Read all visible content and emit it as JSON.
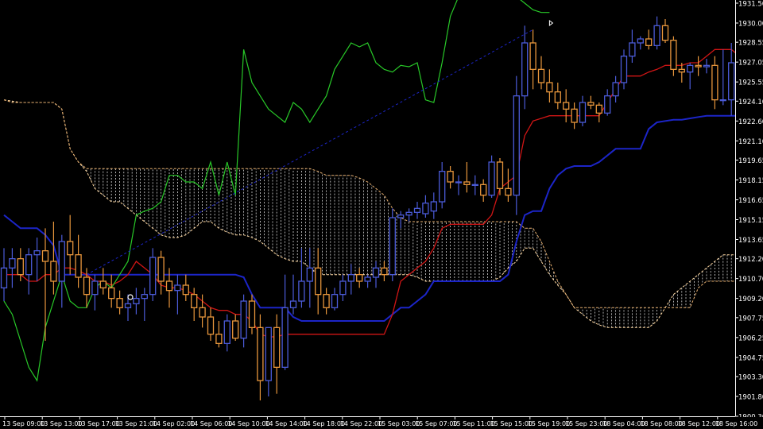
{
  "chart_data": {
    "type": "candlestick",
    "symbol": "",
    "timeframe": "H1",
    "ylim": [
      1900.3,
      1931.5
    ],
    "y_ticks": [
      "1931.50",
      "1930.00",
      "1928.55",
      "1927.05",
      "1925.55",
      "1924.10",
      "1922.60",
      "1921.10",
      "1919.65",
      "1918.15",
      "1916.65",
      "1915.15",
      "1913.65",
      "1912.20",
      "1910.70",
      "1909.20",
      "1907.75",
      "1906.25",
      "1904.75",
      "1903.30",
      "1901.80",
      "1900.30"
    ],
    "x_ticks": [
      "13 Sep 09:00",
      "13 Sep 13:00",
      "13 Sep 17:00",
      "13 Sep 21:00",
      "14 Sep 02:00",
      "14 Sep 06:00",
      "14 Sep 10:00",
      "14 Sep 14:00",
      "14 Sep 18:00",
      "14 Sep 22:00",
      "15 Sep 03:00",
      "15 Sep 07:00",
      "15 Sep 11:00",
      "15 Sep 15:00",
      "15 Sep 19:00",
      "15 Sep 23:00",
      "18 Sep 04:00",
      "18 Sep 08:00",
      "18 Sep 12:00",
      "18 Sep 16:00"
    ],
    "colors": {
      "background": "#000000",
      "bull": "#4b5bd8",
      "bear": "#e8963c",
      "tenkan": "#d01515",
      "kijun": "#1c25c8",
      "chikou": "#28c828",
      "span_a": "#ffd8a0",
      "span_b": "#e8b070",
      "cloud_hatch": "#ffffff",
      "axis_text": "#ffffff"
    },
    "candles": [
      {
        "o": 1910.0,
        "h": 1913.0,
        "l": 1909.0,
        "c": 1911.5
      },
      {
        "o": 1911.5,
        "h": 1913.0,
        "l": 1910.0,
        "c": 1912.2
      },
      {
        "o": 1912.2,
        "h": 1913.0,
        "l": 1910.5,
        "c": 1911.0
      },
      {
        "o": 1911.0,
        "h": 1913.0,
        "l": 1909.5,
        "c": 1912.5
      },
      {
        "o": 1912.5,
        "h": 1913.8,
        "l": 1910.5,
        "c": 1912.8
      },
      {
        "o": 1912.8,
        "h": 1914.5,
        "l": 1906.0,
        "c": 1912.0
      },
      {
        "o": 1912.0,
        "h": 1915.0,
        "l": 1909.5,
        "c": 1910.5
      },
      {
        "o": 1910.5,
        "h": 1914.0,
        "l": 1908.5,
        "c": 1913.5
      },
      {
        "o": 1913.5,
        "h": 1915.5,
        "l": 1911.0,
        "c": 1912.5
      },
      {
        "o": 1912.5,
        "h": 1914.0,
        "l": 1910.0,
        "c": 1910.8
      },
      {
        "o": 1910.8,
        "h": 1911.5,
        "l": 1908.5,
        "c": 1909.5
      },
      {
        "o": 1909.5,
        "h": 1911.0,
        "l": 1908.3,
        "c": 1910.5
      },
      {
        "o": 1910.5,
        "h": 1911.5,
        "l": 1909.5,
        "c": 1910.0
      },
      {
        "o": 1910.0,
        "h": 1911.0,
        "l": 1908.5,
        "c": 1909.2
      },
      {
        "o": 1909.2,
        "h": 1909.8,
        "l": 1908.0,
        "c": 1908.5
      },
      {
        "o": 1908.5,
        "h": 1909.5,
        "l": 1907.5,
        "c": 1908.8
      },
      {
        "o": 1908.8,
        "h": 1910.0,
        "l": 1908.0,
        "c": 1909.2
      },
      {
        "o": 1909.2,
        "h": 1910.0,
        "l": 1907.5,
        "c": 1909.5
      },
      {
        "o": 1909.5,
        "h": 1913.0,
        "l": 1909.0,
        "c": 1912.3
      },
      {
        "o": 1912.3,
        "h": 1912.8,
        "l": 1909.5,
        "c": 1910.5
      },
      {
        "o": 1910.5,
        "h": 1911.5,
        "l": 1908.5,
        "c": 1909.8
      },
      {
        "o": 1909.8,
        "h": 1911.0,
        "l": 1908.0,
        "c": 1910.2
      },
      {
        "o": 1910.2,
        "h": 1911.0,
        "l": 1909.0,
        "c": 1909.5
      },
      {
        "o": 1909.5,
        "h": 1910.0,
        "l": 1907.5,
        "c": 1908.5
      },
      {
        "o": 1908.5,
        "h": 1909.5,
        "l": 1907.0,
        "c": 1907.8
      },
      {
        "o": 1907.8,
        "h": 1908.5,
        "l": 1906.0,
        "c": 1906.5
      },
      {
        "o": 1906.5,
        "h": 1907.5,
        "l": 1905.5,
        "c": 1905.8
      },
      {
        "o": 1905.8,
        "h": 1908.0,
        "l": 1905.2,
        "c": 1907.5
      },
      {
        "o": 1907.5,
        "h": 1908.0,
        "l": 1906.0,
        "c": 1906.2
      },
      {
        "o": 1906.2,
        "h": 1909.5,
        "l": 1905.5,
        "c": 1909.0
      },
      {
        "o": 1909.0,
        "h": 1909.5,
        "l": 1906.5,
        "c": 1907.0
      },
      {
        "o": 1907.0,
        "h": 1908.0,
        "l": 1901.5,
        "c": 1903.0
      },
      {
        "o": 1903.0,
        "h": 1906.0,
        "l": 1901.8,
        "c": 1907.0
      },
      {
        "o": 1907.0,
        "h": 1908.0,
        "l": 1902.0,
        "c": 1904.0
      },
      {
        "o": 1904.0,
        "h": 1911.0,
        "l": 1903.8,
        "c": 1908.5
      },
      {
        "o": 1908.5,
        "h": 1911.0,
        "l": 1908.0,
        "c": 1909.0
      },
      {
        "o": 1909.0,
        "h": 1913.0,
        "l": 1908.5,
        "c": 1910.5
      },
      {
        "o": 1910.5,
        "h": 1913.0,
        "l": 1908.5,
        "c": 1911.5
      },
      {
        "o": 1911.5,
        "h": 1913.0,
        "l": 1908.0,
        "c": 1909.5
      },
      {
        "o": 1909.5,
        "h": 1910.0,
        "l": 1908.0,
        "c": 1908.5
      },
      {
        "o": 1908.5,
        "h": 1910.0,
        "l": 1908.3,
        "c": 1909.5
      },
      {
        "o": 1909.5,
        "h": 1911.0,
        "l": 1909.0,
        "c": 1910.5
      },
      {
        "o": 1910.5,
        "h": 1911.8,
        "l": 1909.5,
        "c": 1911.0
      },
      {
        "o": 1911.0,
        "h": 1911.5,
        "l": 1910.0,
        "c": 1910.5
      },
      {
        "o": 1910.5,
        "h": 1911.0,
        "l": 1910.0,
        "c": 1910.8
      },
      {
        "o": 1910.8,
        "h": 1912.0,
        "l": 1910.0,
        "c": 1911.5
      },
      {
        "o": 1911.5,
        "h": 1912.0,
        "l": 1910.5,
        "c": 1911.0
      },
      {
        "o": 1911.0,
        "h": 1916.0,
        "l": 1910.5,
        "c": 1915.3
      },
      {
        "o": 1915.3,
        "h": 1915.8,
        "l": 1914.5,
        "c": 1915.5
      },
      {
        "o": 1915.5,
        "h": 1916.0,
        "l": 1915.0,
        "c": 1915.7
      },
      {
        "o": 1915.7,
        "h": 1916.5,
        "l": 1915.2,
        "c": 1916.0
      },
      {
        "o": 1915.6,
        "h": 1917.0,
        "l": 1915.3,
        "c": 1916.4
      },
      {
        "o": 1915.8,
        "h": 1917.2,
        "l": 1915.2,
        "c": 1916.5
      },
      {
        "o": 1916.5,
        "h": 1919.5,
        "l": 1916.0,
        "c": 1918.8
      },
      {
        "o": 1918.8,
        "h": 1919.2,
        "l": 1917.5,
        "c": 1918.0
      },
      {
        "o": 1918.0,
        "h": 1918.5,
        "l": 1917.0,
        "c": 1918.0
      },
      {
        "o": 1918.0,
        "h": 1919.5,
        "l": 1917.2,
        "c": 1917.8
      },
      {
        "o": 1917.8,
        "h": 1918.5,
        "l": 1917.0,
        "c": 1917.8
      },
      {
        "o": 1917.8,
        "h": 1918.2,
        "l": 1916.5,
        "c": 1917.0
      },
      {
        "o": 1917.0,
        "h": 1920.0,
        "l": 1916.8,
        "c": 1919.5
      },
      {
        "o": 1919.5,
        "h": 1919.8,
        "l": 1917.0,
        "c": 1917.5
      },
      {
        "o": 1917.5,
        "h": 1919.0,
        "l": 1916.5,
        "c": 1917.0
      },
      {
        "o": 1917.0,
        "h": 1926.0,
        "l": 1915.5,
        "c": 1924.5
      },
      {
        "o": 1924.5,
        "h": 1929.8,
        "l": 1923.5,
        "c": 1928.5
      },
      {
        "o": 1928.5,
        "h": 1929.5,
        "l": 1925.0,
        "c": 1926.5
      },
      {
        "o": 1926.5,
        "h": 1927.5,
        "l": 1925.0,
        "c": 1925.5
      },
      {
        "o": 1925.5,
        "h": 1926.5,
        "l": 1924.0,
        "c": 1924.8
      },
      {
        "o": 1924.8,
        "h": 1925.5,
        "l": 1923.5,
        "c": 1924.0
      },
      {
        "o": 1924.0,
        "h": 1925.0,
        "l": 1922.5,
        "c": 1923.5
      },
      {
        "o": 1923.5,
        "h": 1924.0,
        "l": 1922.0,
        "c": 1922.5
      },
      {
        "o": 1922.5,
        "h": 1924.5,
        "l": 1922.2,
        "c": 1924.0
      },
      {
        "o": 1924.0,
        "h": 1924.5,
        "l": 1923.5,
        "c": 1923.8
      },
      {
        "o": 1923.8,
        "h": 1924.0,
        "l": 1922.5,
        "c": 1923.2
      },
      {
        "o": 1923.2,
        "h": 1925.0,
        "l": 1923.0,
        "c": 1924.5
      },
      {
        "o": 1924.5,
        "h": 1926.0,
        "l": 1924.0,
        "c": 1925.5
      },
      {
        "o": 1925.5,
        "h": 1928.0,
        "l": 1925.0,
        "c": 1927.5
      },
      {
        "o": 1927.5,
        "h": 1929.5,
        "l": 1927.0,
        "c": 1928.5
      },
      {
        "o": 1928.5,
        "h": 1929.0,
        "l": 1928.0,
        "c": 1928.8
      },
      {
        "o": 1928.8,
        "h": 1929.5,
        "l": 1928.0,
        "c": 1928.3
      },
      {
        "o": 1928.3,
        "h": 1930.5,
        "l": 1928.0,
        "c": 1929.8
      },
      {
        "o": 1929.8,
        "h": 1930.3,
        "l": 1928.5,
        "c": 1928.7
      },
      {
        "o": 1928.7,
        "h": 1929.0,
        "l": 1926.0,
        "c": 1926.5
      },
      {
        "o": 1926.5,
        "h": 1927.0,
        "l": 1925.5,
        "c": 1926.3
      },
      {
        "o": 1926.3,
        "h": 1927.0,
        "l": 1925.0,
        "c": 1926.8
      },
      {
        "o": 1926.8,
        "h": 1927.5,
        "l": 1926.0,
        "c": 1926.7
      },
      {
        "o": 1926.7,
        "h": 1927.3,
        "l": 1926.2,
        "c": 1926.8
      },
      {
        "o": 1926.8,
        "h": 1927.5,
        "l": 1923.5,
        "c": 1924.2
      },
      {
        "o": 1924.2,
        "h": 1928.0,
        "l": 1923.8,
        "c": 1924.2
      },
      {
        "o": 1924.2,
        "h": 1928.5,
        "l": 1923.0,
        "c": 1927.0
      }
    ],
    "tenkan": [
      1911.0,
      1911.0,
      1911.0,
      1910.5,
      1910.5,
      1911.0,
      1911.0,
      1911.5,
      1911.5,
      1911.3,
      1911.0,
      1910.5,
      1910.5,
      1910.2,
      1910.5,
      1911.0,
      1912.0,
      1911.5,
      1911.0,
      1910.2,
      1910.0,
      1910.0,
      1909.8,
      1909.5,
      1909.0,
      1908.5,
      1908.3,
      1908.3,
      1908.0,
      1908.0,
      1907.5,
      1906.5,
      1906.3,
      1906.3,
      1906.5,
      1906.5,
      1906.5,
      1906.5,
      1906.5,
      1906.5,
      1906.5,
      1906.5,
      1906.5,
      1906.5,
      1906.5,
      1906.5,
      1906.5,
      1908.0,
      1910.5,
      1911.0,
      1911.5,
      1912.0,
      1913.0,
      1914.5,
      1914.8,
      1914.8,
      1914.8,
      1914.8,
      1914.8,
      1915.5,
      1917.5,
      1918.0,
      1918.5,
      1921.5,
      1922.6,
      1922.8,
      1923.0,
      1923.0,
      1923.0,
      1923.0,
      1923.0,
      1923.0,
      1923.0,
      1924.0,
      1925.0,
      1926.0,
      1926.0,
      1926.0,
      1926.3,
      1926.5,
      1926.8,
      1926.8,
      1926.8,
      1927.0,
      1927.0,
      1927.5,
      1928.0,
      1928.0,
      1928.0,
      1927.5
    ],
    "kijun": [
      1915.5,
      1915.0,
      1914.5,
      1914.5,
      1914.5,
      1914.0,
      1913.2,
      1911.0,
      1911.0,
      1911.0,
      1911.0,
      1911.0,
      1911.0,
      1911.0,
      1911.0,
      1911.0,
      1911.0,
      1911.0,
      1911.0,
      1911.0,
      1911.0,
      1911.0,
      1911.0,
      1911.0,
      1911.0,
      1911.0,
      1911.0,
      1911.0,
      1911.0,
      1910.8,
      1909.5,
      1908.5,
      1908.5,
      1908.5,
      1908.5,
      1907.8,
      1907.5,
      1907.5,
      1907.5,
      1907.5,
      1907.5,
      1907.5,
      1907.5,
      1907.5,
      1907.5,
      1907.5,
      1907.5,
      1908.0,
      1908.5,
      1908.5,
      1909.0,
      1909.5,
      1910.5,
      1910.5,
      1910.5,
      1910.5,
      1910.5,
      1910.5,
      1910.5,
      1910.5,
      1910.5,
      1911.0,
      1913.5,
      1915.5,
      1915.8,
      1915.8,
      1917.5,
      1918.5,
      1919.0,
      1919.2,
      1919.2,
      1919.2,
      1919.5,
      1920.0,
      1920.5,
      1920.5,
      1920.5,
      1920.5,
      1922.0,
      1922.5,
      1922.6,
      1922.7,
      1922.7,
      1922.8,
      1922.9,
      1923.0,
      1923.0,
      1923.0,
      1923.0,
      1923.0
    ],
    "chikou": [
      1909.0,
      1908.0,
      1906.0,
      1904.0,
      1903.0,
      1907.0,
      1909.0,
      1911.0,
      1909.0,
      1908.5,
      1908.5,
      1910.0,
      1910.5,
      1910.0,
      1911.0,
      1912.0,
      1915.5,
      1915.8,
      1916.0,
      1916.5,
      1918.5,
      1918.5,
      1918.0,
      1918.0,
      1917.5,
      1919.5,
      1917.0,
      1919.5,
      1917.0,
      1928.0,
      1925.5,
      1924.5,
      1923.5,
      1923.0,
      1922.5,
      1924.0,
      1923.5,
      1922.5,
      1923.5,
      1924.5,
      1926.5,
      1927.5,
      1928.5,
      1928.2,
      1928.5,
      1927.0,
      1926.5,
      1926.3,
      1926.8,
      1926.7,
      1927.0,
      1924.2,
      1924.0,
      1927.0,
      1930.5,
      1932.0,
      1933.0,
      1934.0,
      1933.0,
      1932.5,
      1932.0,
      1932.5,
      1932.0,
      1931.5,
      1931.0,
      1930.8,
      1930.8
    ],
    "span_a": [
      1924.2,
      1924.1,
      1924.0,
      1924.0,
      1924.0,
      1924.0,
      1924.0,
      1923.5,
      1920.5,
      1919.5,
      1918.8,
      1917.5,
      1917.0,
      1916.5,
      1916.5,
      1916.0,
      1915.5,
      1915.0,
      1914.5,
      1914.0,
      1913.8,
      1913.8,
      1914.0,
      1914.5,
      1915.0,
      1915.0,
      1914.5,
      1914.2,
      1914.0,
      1914.0,
      1913.8,
      1913.5,
      1913.0,
      1912.5,
      1912.2,
      1912.0,
      1912.0,
      1911.5,
      1911.0,
      1911.0,
      1911.0,
      1911.0,
      1911.0,
      1911.0,
      1911.0,
      1911.0,
      1911.0,
      1911.0,
      1911.0,
      1911.0,
      1910.8,
      1910.5,
      1910.5,
      1910.5,
      1910.5,
      1910.5,
      1910.5,
      1910.5,
      1910.5,
      1910.5,
      1910.8,
      1911.5,
      1912.0,
      1913.0,
      1913.0,
      1912.0,
      1911.0,
      1910.2,
      1909.5,
      1908.5,
      1908.0,
      1907.5,
      1907.2,
      1907.0,
      1907.0,
      1907.0,
      1907.0,
      1907.0,
      1907.0,
      1907.5,
      1908.5,
      1909.5,
      1910.0,
      1910.5,
      1911.0,
      1911.5,
      1912.0,
      1912.5,
      1912.5,
      1912.5,
      1912.5,
      1912.5,
      1913.0,
      1913.5,
      1913.8,
      1914.0,
      1914.0,
      1914.0
    ],
    "span_b": [
      1924.2,
      1924.0,
      1924.0,
      1924.0,
      1924.0,
      1924.0,
      1924.0,
      1923.5,
      1920.5,
      1919.5,
      1919.0,
      1919.0,
      1919.0,
      1919.0,
      1919.0,
      1919.0,
      1919.0,
      1919.0,
      1919.0,
      1919.0,
      1919.0,
      1919.0,
      1919.0,
      1919.0,
      1919.0,
      1919.0,
      1919.0,
      1919.0,
      1919.0,
      1919.0,
      1919.0,
      1919.0,
      1919.0,
      1919.0,
      1919.0,
      1919.0,
      1919.0,
      1919.0,
      1918.8,
      1918.5,
      1918.5,
      1918.5,
      1918.5,
      1918.3,
      1918.0,
      1917.5,
      1917.0,
      1916.0,
      1915.3,
      1915.0,
      1915.0,
      1915.0,
      1915.0,
      1915.0,
      1915.0,
      1915.0,
      1915.0,
      1915.0,
      1915.0,
      1915.0,
      1915.0,
      1915.0,
      1915.0,
      1914.5,
      1914.5,
      1913.5,
      1912.0,
      1910.5,
      1909.5,
      1908.5,
      1908.5,
      1908.5,
      1908.5,
      1908.5,
      1908.5,
      1908.5,
      1908.5,
      1908.5,
      1908.5,
      1908.5,
      1908.5,
      1908.5,
      1908.5,
      1908.5,
      1910.0,
      1910.5,
      1910.5,
      1910.5,
      1910.5,
      1910.5,
      1910.5,
      1910.5,
      1910.5,
      1910.5,
      1910.5,
      1910.5,
      1910.5,
      1910.5
    ],
    "trendline": {
      "from": [
        10,
        1911.0
      ],
      "to": [
        64,
        1929.5
      ]
    },
    "markers": [
      {
        "x": 15,
        "y": 1909.3,
        "kind": "circle"
      },
      {
        "x": 66,
        "y": 1930.0,
        "kind": "arrow"
      }
    ]
  }
}
